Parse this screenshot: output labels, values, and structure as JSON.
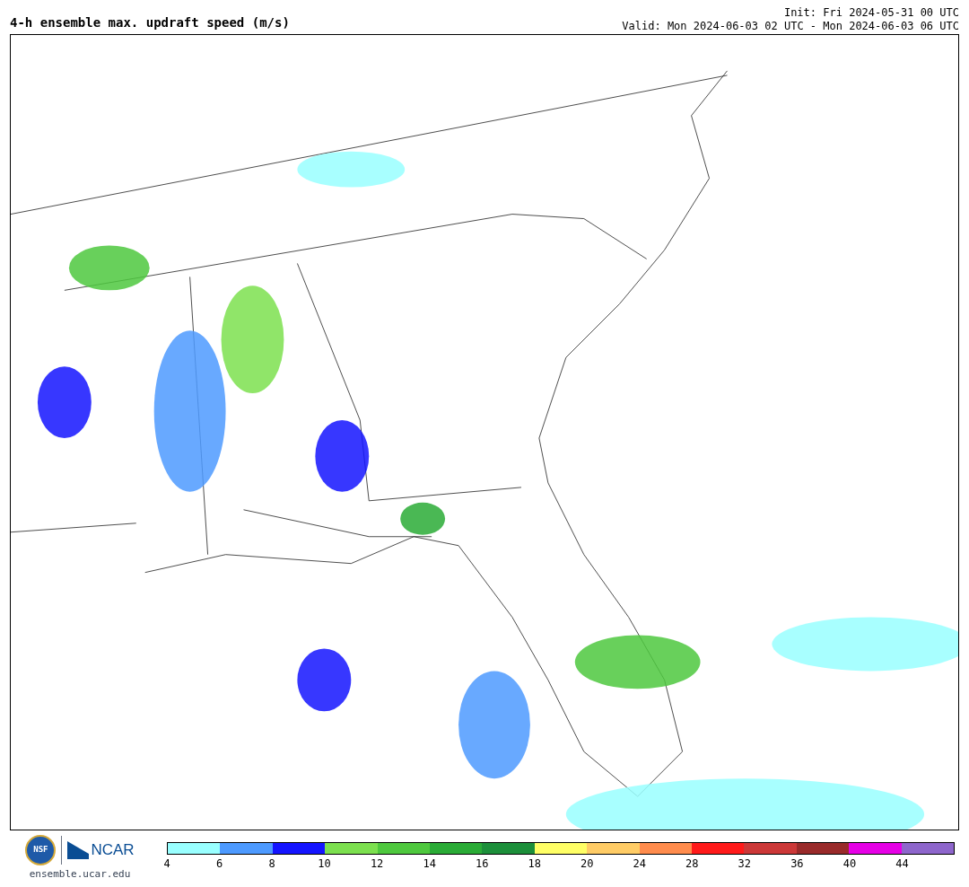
{
  "title": "4-h ensemble max. updraft speed (m/s)",
  "init": "Init: Fri 2024-05-31 00 UTC",
  "valid": "Valid: Mon 2024-06-03 02 UTC - Mon 2024-06-03 06 UTC",
  "logos": {
    "nsf": "NSF",
    "ncar": "NCAR",
    "url": "ensemble.ucar.edu"
  },
  "legend": [
    {
      "label": "4",
      "color": "#99ffff"
    },
    {
      "label": "6",
      "color": "#4d9aff"
    },
    {
      "label": "8",
      "color": "#1414ff"
    },
    {
      "label": "10",
      "color": "#7ce04f"
    },
    {
      "label": "12",
      "color": "#4ec83e"
    },
    {
      "label": "14",
      "color": "#2aab36"
    },
    {
      "label": "16",
      "color": "#1c8f3a"
    },
    {
      "label": "18",
      "color": "#ffff66"
    },
    {
      "label": "20",
      "color": "#ffcc66"
    },
    {
      "label": "24",
      "color": "#ff8c4d"
    },
    {
      "label": "28",
      "color": "#ff1a1a"
    },
    {
      "label": "32",
      "color": "#cc3838"
    },
    {
      "label": "36",
      "color": "#992a2a"
    },
    {
      "label": "40",
      "color": "#e600e6"
    },
    {
      "label": "44",
      "color": "#8e66cc"
    }
  ]
}
